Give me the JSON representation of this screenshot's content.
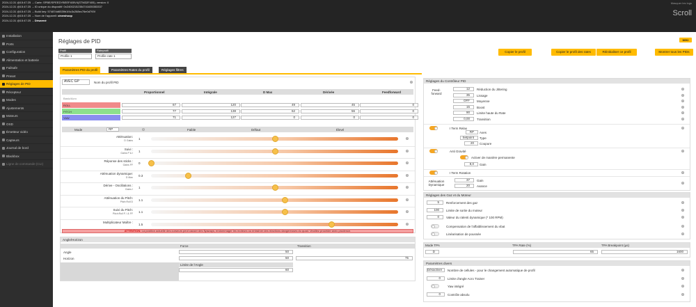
{
  "log": [
    {
      "time": "2024-12-31 @15:47:25",
      "text": "-- Carte: SPBE/SPEEDYBEEF405V4(STM32F405), version: 0"
    },
    {
      "time": "2024-12-31 @15:47:25",
      "text": "-- ID unique du dispositif: 0x24002152354741635353337"
    },
    {
      "time": "2024-12-31 @15:47:25",
      "text": "-- Build key: 57487dd6539b1f4c3c268ec76e0d793f"
    },
    {
      "time": "2024-12-31 @15:47:25",
      "text": "-- Nom de l'appareil:",
      "bold": "cinewhoop"
    },
    {
      "time": "2024-12-31 @15:47:25",
      "text": "--",
      "bold": "Désarmé"
    }
  ],
  "log_hint": "Masquer les logs",
  "log_scroll": "Scroll",
  "sidebar": [
    "Installation",
    "Ports",
    "Configuration",
    "Alimentation et batterie",
    "Failsafe",
    "Preset",
    "Réglages de PID",
    "Récepteur",
    "Modes",
    "Ajustements",
    "Moteurs",
    "OSD",
    "Émetteur vidéo",
    "Capteurs",
    "Journal de bord",
    "Blackbox",
    "Ligne de commande (CLI)"
  ],
  "sidebar_active": 6,
  "title": "Réglages de PID",
  "wiki": "WIKI",
  "profile": {
    "label": "Profil",
    "value": "Profile 1"
  },
  "rateprofile": {
    "label": "Rateprofil",
    "value": "Profile rate 1"
  },
  "buttons": {
    "copy_profile": "Copier le profil",
    "copy_rates": "Copier le profil des rates",
    "reset_profile": "Réinitialiser ce profil",
    "show_all": "Montrer tous les PIDs"
  },
  "tabs": [
    "Paramètres PID du profil",
    "Paramètres Rates du profil",
    "Réglages filtres"
  ],
  "profile_name": {
    "value": "AVEC GP",
    "label": "Nom du profil PID"
  },
  "pid_headers": [
    "Proportionnel",
    "Intégrale",
    "D Max",
    "Dérivée",
    "Feedforward"
  ],
  "basic_label": "Basic/Acro",
  "pid_rows": [
    {
      "name": "ROLL",
      "color": "#f08a8a",
      "values": [
        "67",
        "120",
        "49",
        "45",
        "0"
      ]
    },
    {
      "name": "PITCH",
      "color": "#8de08d",
      "values": [
        "77",
        "138",
        "62",
        "56",
        "0"
      ]
    },
    {
      "name": "YAW",
      "color": "#8a8ef0",
      "values": [
        "71",
        "127",
        "0",
        "0",
        "0"
      ]
    }
  ],
  "slider_header": {
    "mode_label": "Mode",
    "mode_value": "RP",
    "low": "Faible",
    "default": "Défaut",
    "high": "Élevé"
  },
  "sliders": [
    {
      "label": "Atténuation:",
      "sub": "D Gains",
      "value": "1",
      "pos": 0.5
    },
    {
      "label": "Suivi :",
      "sub": "Gains P & I",
      "value": "1",
      "pos": 0.5
    },
    {
      "label": "Réponse des sticks :",
      "sub": "Gains FF",
      "value": "0",
      "pos": 0.0
    },
    {
      "label": "Atténuation dynamique:",
      "sub": "D Max",
      "value": "0.3",
      "pos": 0.15
    },
    {
      "label": "Dérive - Oscillations :",
      "sub": "Gains I",
      "value": "1",
      "pos": 0.5
    },
    {
      "label": "Atténuation du Pitch:",
      "sub": "Pitch:Roll D",
      "value": "1.1",
      "pos": 0.54
    },
    {
      "label": "Suivi du Pitch:",
      "sub": "Pitch:Roll P, I & FF",
      "value": "1.1",
      "pos": 0.54
    },
    {
      "label": "Multiplicateur Maître :",
      "sub": "",
      "value": "1.5",
      "pos": 0.73
    }
  ],
  "warning": {
    "strong": "ATTENTION:",
    "text": "La position actuelle des curseurs peut causer des flyaways, endommager les moteurs ou entraîner des réactions dangereuses du quad. Veuillez procéder avec prudence."
  },
  "angle": {
    "header": "Angle/Horizon",
    "force": "Force",
    "transition": "Transition",
    "angle_label": "Angle",
    "horizon_label": "Horizon",
    "angle_val": "50",
    "horizon_val": "50",
    "transition_val": "75",
    "limit_label": "Limite de l'Angle",
    "limit_val": "60"
  },
  "controller": {
    "header": "Réglages du Contrôleur PID",
    "ff_label": "Feed-forward",
    "ff_rows": [
      {
        "value": "12",
        "label": "Réduction du Jittering"
      },
      {
        "value": "35",
        "label": "Lissage"
      },
      {
        "value": "OFF",
        "label": "Moyenne"
      },
      {
        "value": "15",
        "label": "Boost"
      },
      {
        "value": "90",
        "label": "Limite haute du Rate"
      },
      {
        "value": "0,00",
        "label": "Transition"
      }
    ],
    "iterm_relax": "I Term Relax",
    "axes_val": "RP",
    "axes_label": "Axes",
    "type_val": "Setpoint",
    "type_label": "Type",
    "cutoff_val": "20",
    "cutoff_label": "Coupure",
    "anti_gravity": "Anti Gravité",
    "ag_perm": "Activer de manière permanente",
    "gain_val": "8,0",
    "gain_label": "Gain",
    "iterm_rot": "I Term Rotation",
    "dyn_label": "Atténuation Dynamique",
    "dyn_gain_val": "37",
    "dyn_gain_label": "Gain",
    "dyn_adv_val": "20",
    "dyn_adv_label": "Avance"
  },
  "throttle": {
    "header": "Réglages des Gaz et du Moteur",
    "rows": [
      {
        "value": "5",
        "label": "Renforcement des gaz"
      },
      {
        "value": "100",
        "label": "Limite de sortie du moteur"
      },
      {
        "value": "0",
        "label": "Valeur du ralenti dynamique (* 100 RPM)"
      }
    ],
    "comp": "Compensation de l'affaiblissement du vbat",
    "smooth": "Linéarisation de poussée"
  },
  "tpa": {
    "mode": "Mode TPA",
    "rate": "TPA Rate (%)",
    "breakpoint": "TPA Breakpoint (µs)",
    "mode_val": "D",
    "rate_val": "65",
    "bp_val": "1600"
  },
  "misc": {
    "header": "Paramètres divers",
    "rows": [
      {
        "value": "Désactiver",
        "label": "Nombre de cellules - pour le changement automatique de profil"
      },
      {
        "value": "0",
        "label": "Limite d'angle Acro Trainer"
      },
      {
        "value": "",
        "label": "Yaw intégré"
      },
      {
        "value": "0",
        "label": "Contrôle absolu"
      }
    ]
  }
}
